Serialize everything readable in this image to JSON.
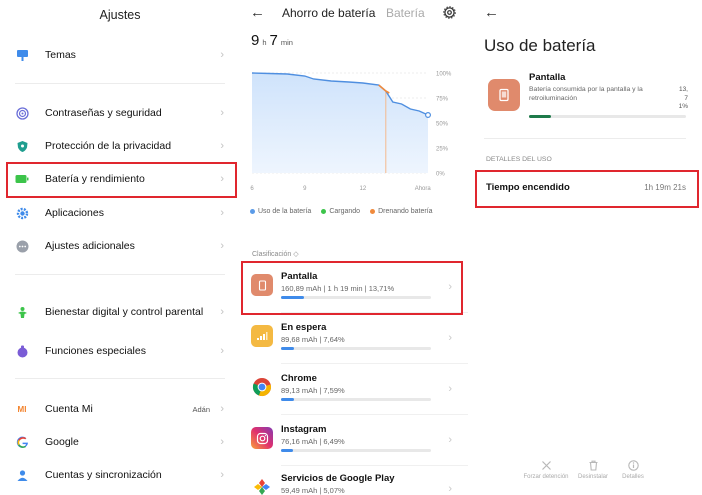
{
  "settings": {
    "title": "Ajustes",
    "items": [
      {
        "label": "Temas",
        "icon": "themes-icon",
        "color": "#3f8bea"
      },
      {
        "label": "Contraseñas y seguridad",
        "icon": "fingerprint-icon",
        "color": "#6b6fd8"
      },
      {
        "label": "Protección de la privacidad",
        "icon": "privacy-shield-icon",
        "color": "#1f9e8f"
      },
      {
        "label": "Batería y rendimiento",
        "icon": "battery-icon",
        "color": "#3cc44a"
      },
      {
        "label": "Aplicaciones",
        "icon": "gear-icon",
        "color": "#3f8bea"
      },
      {
        "label": "Ajustes adicionales",
        "icon": "more-icon",
        "color": "#9aa0aa"
      },
      {
        "label": "Bienestar digital y control parental",
        "icon": "wellbeing-icon",
        "color": "#3cc44a"
      },
      {
        "label": "Funciones especiales",
        "icon": "special-features-icon",
        "color": "#7a5cd6"
      },
      {
        "label": "Cuenta Mi",
        "icon": "mi-icon",
        "color": "#f3822b",
        "value": "Adán",
        "glyph": "MI"
      },
      {
        "label": "Google",
        "icon": "google-icon",
        "color": "#4285f4"
      },
      {
        "label": "Cuentas y sincronización",
        "icon": "account-icon",
        "color": "#3f8bea"
      }
    ]
  },
  "battery_saver": {
    "tab_active": "Ahorro de batería",
    "tab_inactive": "Batería",
    "remaining": {
      "hours": "9",
      "h_unit": "h",
      "minutes": "7",
      "min_unit": "min"
    },
    "legend": [
      {
        "label": "Uso de la batería",
        "color": "#5b9be8"
      },
      {
        "label": "Cargando",
        "color": "#3cc44a"
      },
      {
        "label": "Drenando batería",
        "color": "#f08a3c"
      }
    ],
    "sort_label": "Clasificación ◇",
    "apps": [
      {
        "name": "Pantalla",
        "stat": "160,89 mAh | 1 h 19 min  | 13,71%",
        "usage_fraction": 0.14,
        "icon": "screen-icon",
        "color": "#e08a6c"
      },
      {
        "name": "En espera",
        "stat": "89,68 mAh | 7,64%",
        "usage_fraction": 0.08,
        "icon": "signal-icon",
        "color": "#f4b942"
      },
      {
        "name": "Chrome",
        "stat": "89,13 mAh | 7,59%",
        "usage_fraction": 0.08,
        "icon": "chrome-icon",
        "color": "#ffffff"
      },
      {
        "name": "Instagram",
        "stat": "76,16 mAh | 6,49%",
        "usage_fraction": 0.07,
        "icon": "instagram-icon",
        "color": "#c13584"
      },
      {
        "name": "Servicios de Google Play",
        "stat": "59,49 mAh | 5,07%",
        "usage_fraction": 0.05,
        "icon": "google-play-services-icon",
        "color": "#4caf50"
      }
    ]
  },
  "chart_data": {
    "type": "area",
    "x_ticks": [
      "6",
      "9",
      "12",
      "Ahora"
    ],
    "y_ticks": [
      "100%",
      "75%",
      "50%",
      "25%",
      "0%"
    ],
    "ylim": [
      0,
      100
    ],
    "grid": true,
    "series": [
      {
        "name": "Uso de la batería",
        "x": [
          0,
          0.1,
          0.2,
          0.3,
          0.35,
          0.45,
          0.55,
          0.63,
          0.72,
          0.76,
          0.8,
          0.85,
          0.9,
          0.95,
          1.0
        ],
        "values": [
          100,
          99.5,
          99,
          97,
          94,
          92,
          91,
          90,
          88,
          82,
          71,
          69,
          64,
          62,
          58
        ]
      },
      {
        "name": "Drenando batería",
        "x": [
          0.72,
          0.76,
          0.78
        ],
        "values": [
          88,
          82,
          80
        ]
      }
    ]
  },
  "usage": {
    "title": "Uso de batería",
    "app_name": "Pantalla",
    "description": "Batería consumida por la pantalla y la retroiluminación",
    "percent": "13,71%",
    "usage_fraction": 0.14,
    "section_title": "DETALLES DEL USO",
    "row_label": "Tiempo encendido",
    "row_value": "1h 19m 21s",
    "actions": [
      {
        "label": "Forzar detención",
        "icon": "close-icon"
      },
      {
        "label": "Desinstalar",
        "icon": "trash-icon"
      },
      {
        "label": "Detalles",
        "icon": "info-icon"
      }
    ]
  }
}
